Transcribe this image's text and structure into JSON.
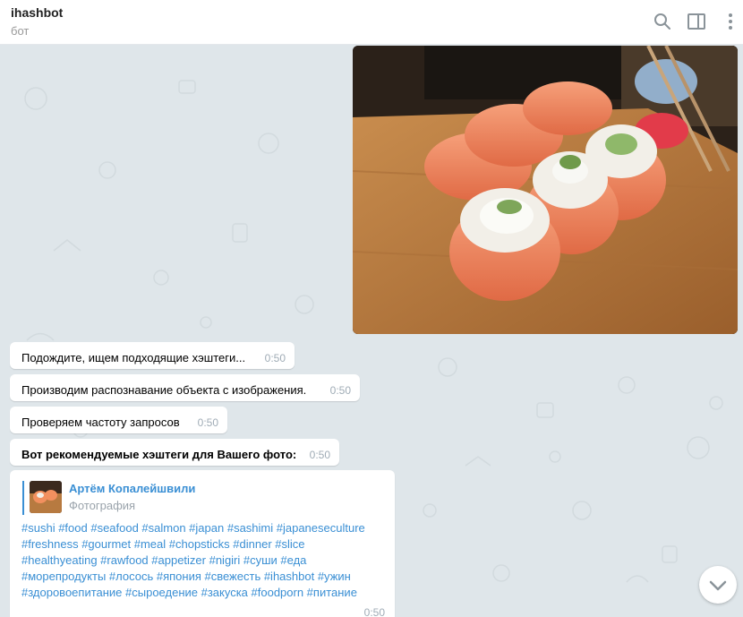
{
  "header": {
    "title": "ihashbot",
    "subtitle": "бот",
    "icons": [
      "search-icon",
      "sidebar-toggle-icon",
      "more-vertical-icon"
    ]
  },
  "photo": {
    "subject": "sushi-rolls-photo"
  },
  "messages": [
    {
      "text": "Подождите, ищем подходящие хэштеги...",
      "time": "0:50",
      "bold": false
    },
    {
      "text": "Производим распознавание объекта с изображения.",
      "time": "0:50",
      "bold": false
    },
    {
      "text": "Проверяем частоту запросов",
      "time": "0:50",
      "bold": false
    },
    {
      "text": "Вот рекомендуемые хэштеги для Вашего фото:",
      "time": "0:50",
      "bold": true
    }
  ],
  "forwarded": {
    "author": "Артём Копалейшвили",
    "type": "Фотография",
    "tag_lines": [
      "#sushi #food #seafood #salmon #japan #sashimi #japaneseculture",
      "#freshness #gourmet #meal #chopsticks #dinner #slice",
      "#healthyeating #rawfood #appetizer #nigiri #суши #еда",
      "#морепродукты #лосось #япония #свежесть #ihashbot #ужин",
      "#здоровоепитание #сыроедение #закуска #foodporn #питание"
    ],
    "time": "0:50"
  },
  "scroll_button": {
    "icon": "chevron-down-icon"
  },
  "colors": {
    "link": "#3a8fd4",
    "background": "#dfe6ea",
    "time": "#a0acb6"
  }
}
